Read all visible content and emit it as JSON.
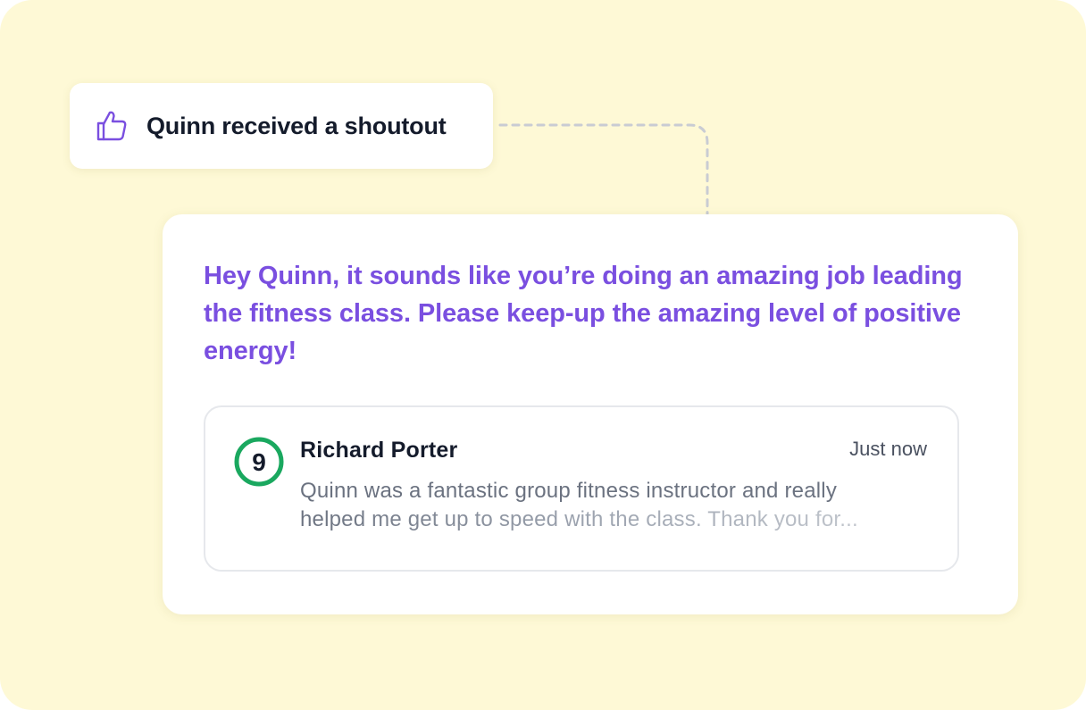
{
  "notification": {
    "icon": "thumbs-up-icon",
    "title": "Quinn received a shoutout"
  },
  "shoutout": {
    "message": "Hey Quinn, it sounds like you’re doing an amazing job leading the fitness class. Please keep-up the amazing level of positive energy!"
  },
  "comment": {
    "avatar_label": "9",
    "author": "Richard Porter",
    "timestamp": "Just now",
    "body_line1": "Quinn was a fantastic group fitness instructor and really",
    "body_line2": "helped me get up to speed with the class. Thank you for..."
  },
  "colors": {
    "background": "#fef9d6",
    "accent_purple": "#7a4fe0",
    "avatar_green": "#1aa85f",
    "connector_gray": "#c9ccd3"
  }
}
